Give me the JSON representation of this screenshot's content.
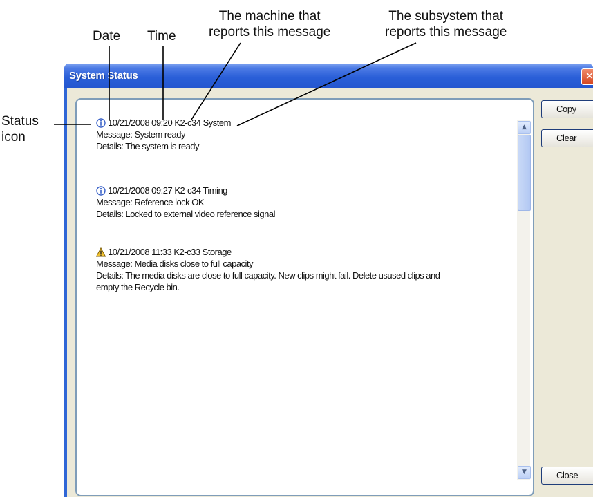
{
  "annotations": {
    "date": "Date",
    "time": "Time",
    "machine_line1": "The machine that",
    "machine_line2": "reports this message",
    "subsystem_line1": "The subsystem that",
    "subsystem_line2": "reports this message",
    "status_line1": "Status",
    "status_line2": "icon"
  },
  "window": {
    "title": "System Status",
    "close_glyph": "✕"
  },
  "log": [
    {
      "icon": "info-icon",
      "header": "10/21/2008 09:20 K2-c34 System",
      "message": "Message: System ready",
      "details": "Details: The system is ready"
    },
    {
      "icon": "info-icon",
      "header": "10/21/2008 09:27 K2-c34 Timing",
      "message": "Message: Reference lock OK",
      "details": "Details: Locked to external video reference signal"
    },
    {
      "icon": "warning-icon",
      "header": "10/21/2008 11:33 K2-c33 Storage",
      "message": "Message: Media disks close to full capacity",
      "details": "Details: The media disks are close to full capacity. New clips might fail. Delete usused clips and",
      "details_cont": "empty the Recycle bin."
    }
  ],
  "buttons": {
    "copy": "Copy",
    "clear": "Clear",
    "close": "Close"
  },
  "scrollbar": {
    "up_glyph": "▲",
    "down_glyph": "▼"
  },
  "colors": {
    "title_bar": "#2a5fd8",
    "info_icon": "#3a62c8",
    "warning_icon": "#f2c230"
  }
}
